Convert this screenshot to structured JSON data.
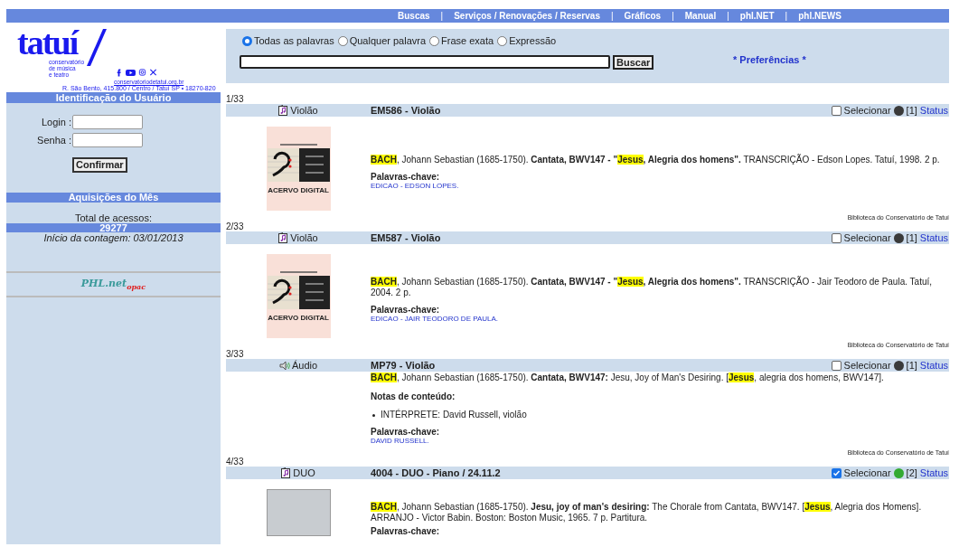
{
  "nav": [
    {
      "kind": "link",
      "text": "Buscas"
    },
    {
      "kind": "separator",
      "text": "|"
    },
    {
      "kind": "link",
      "text": "Serviços / Renovações / Reservas"
    },
    {
      "kind": "separator",
      "text": "|"
    },
    {
      "kind": "link",
      "text": "Gráficos"
    },
    {
      "kind": "separator",
      "text": "|"
    },
    {
      "kind": "link",
      "text": "Manual"
    },
    {
      "kind": "separator",
      "text": "|"
    },
    {
      "kind": "link",
      "text": "phl.NET"
    },
    {
      "kind": "separator",
      "text": "|"
    },
    {
      "kind": "link",
      "text": "phl.NEWS"
    }
  ],
  "logo": {
    "wordmark": "tatuí",
    "tagline": [
      "conservatório",
      "de música",
      "e teatro"
    ],
    "website": "conservatoriodetatui.org.br",
    "address": "R. São Bento, 415.800 / Centro / Tatuí SP • 18270-820"
  },
  "login_panel": {
    "title": "Identificação do Usuário",
    "fields": [
      {
        "label": "Login :"
      },
      {
        "label": "Senha :"
      }
    ],
    "button": "Confirmar"
  },
  "acquisitions": {
    "title": "Aquisições do Mês",
    "access_label": "Total de acessos:",
    "access_count": "29277",
    "count_start": "Início da contagem: 03/01/2013"
  },
  "footer_logo": {
    "main": "PHL.net",
    "accent": "opac"
  },
  "search": {
    "modes": [
      {
        "label": "Todas as palavras",
        "selected": true
      },
      {
        "label": "Qualquer palavra",
        "selected": false
      },
      {
        "label": "Frase exata",
        "selected": false
      },
      {
        "label": "Expressão",
        "selected": false
      }
    ],
    "button": "Buscar",
    "preferences": "* Preferências *"
  },
  "records": [
    {
      "counter": "1/33",
      "kind": "score",
      "type_label": "Violão",
      "title": "EM586 - Violão",
      "selected": false,
      "select_label": "Selecionar",
      "color": "#3a3a3a",
      "copies": "[1]",
      "status_link": "Status",
      "cover": {
        "kind": "logo",
        "caption": "ACERVO DIGITAL"
      },
      "citation": [
        {
          "text": "BACH",
          "bold": true,
          "highlight": true
        },
        {
          "text": ", Johann Sebastian (1685-1750). ",
          "bold": false,
          "highlight": false
        },
        {
          "text": "Cantata, BWV147 - \"",
          "bold": true,
          "highlight": false
        },
        {
          "text": "Jesus",
          "bold": true,
          "highlight": true
        },
        {
          "text": ", Alegria dos homens\".",
          "bold": true,
          "highlight": false
        },
        {
          "text": " TRANSCRIÇÃO - Edson Lopes. Tatuí, 1998. 2 p.",
          "bold": false,
          "highlight": false
        }
      ],
      "keywords_label": "Palavras-chave:",
      "keywords": "EDICAO - EDSON LOPES.",
      "library": "Biblioteca do Conservatório de Tatuí"
    },
    {
      "counter": "2/33",
      "kind": "score",
      "type_label": "Violão",
      "title": "EM587 - Violão",
      "selected": false,
      "select_label": "Selecionar",
      "color": "#3a3a3a",
      "copies": "[1]",
      "status_link": "Status",
      "cover": {
        "kind": "logo",
        "caption": "ACERVO DIGITAL"
      },
      "citation": [
        {
          "text": "BACH",
          "bold": true,
          "highlight": true
        },
        {
          "text": ", Johann Sebastian (1685-1750). ",
          "bold": false,
          "highlight": false
        },
        {
          "text": "Cantata, BWV147 - \"",
          "bold": true,
          "highlight": false
        },
        {
          "text": "Jesus",
          "bold": true,
          "highlight": true
        },
        {
          "text": ", Alegria dos homens\".",
          "bold": true,
          "highlight": false
        },
        {
          "text": " TRANSCRIÇÃO - Jair Teodoro de Paula. Tatuí, 2004. 2 p.",
          "bold": false,
          "highlight": false
        }
      ],
      "keywords_label": "Palavras-chave:",
      "keywords": "EDICAO - JAIR TEODORO DE PAULA.",
      "library": "Biblioteca do Conservatório de Tatuí"
    },
    {
      "counter": "3/33",
      "kind": "audio",
      "type_label": "Áudio",
      "title": "MP79 - Violão",
      "selected": false,
      "select_label": "Selecionar",
      "color": "#3a3a3a",
      "copies": "[1]",
      "status_link": "Status",
      "citation": [
        {
          "text": "BACH",
          "bold": true,
          "highlight": true
        },
        {
          "text": ", Johann Sebastian (1685-1750). ",
          "bold": false,
          "highlight": false
        },
        {
          "text": "Cantata, BWV147:",
          "bold": true,
          "highlight": false
        },
        {
          "text": " Jesu, Joy of Man's Desiring. [",
          "bold": false,
          "highlight": false
        },
        {
          "text": "Jesus",
          "bold": true,
          "highlight": true
        },
        {
          "text": ", alegria dos homens, BWV147].",
          "bold": false,
          "highlight": false
        }
      ],
      "notes_label": "Notas de conteúdo:",
      "notes": [
        "INTÉRPRETE: David Russell, violão"
      ],
      "keywords_label": "Palavras-chave:",
      "keywords": "DAVID RUSSELL.",
      "library": "Biblioteca do Conservatório de Tatuí"
    },
    {
      "counter": "4/33",
      "kind": "score",
      "type_label": "DUO",
      "title": "4004 - DUO - Piano / 24.11.2",
      "selected": true,
      "select_label": "Selecionar",
      "color": "#33aa33",
      "copies": "[2]",
      "status_link": "Status",
      "cover": {
        "kind": "photo"
      },
      "citation": [
        {
          "text": "BACH",
          "bold": true,
          "highlight": true
        },
        {
          "text": ", Johann Sebastian (1685-1750). ",
          "bold": false,
          "highlight": false
        },
        {
          "text": "Jesu, joy of man's desiring:",
          "bold": true,
          "highlight": false
        },
        {
          "text": " The Chorale from Cantata, BWV147. [",
          "bold": false,
          "highlight": false
        },
        {
          "text": "Jesus",
          "bold": true,
          "highlight": true
        },
        {
          "text": ", Alegria dos Homens]. ARRANJO - Victor Babin. Boston: Boston Music, 1965. 7 p. Partitura.",
          "bold": false,
          "highlight": false
        }
      ],
      "keywords_label": "Palavras-chave:"
    }
  ]
}
